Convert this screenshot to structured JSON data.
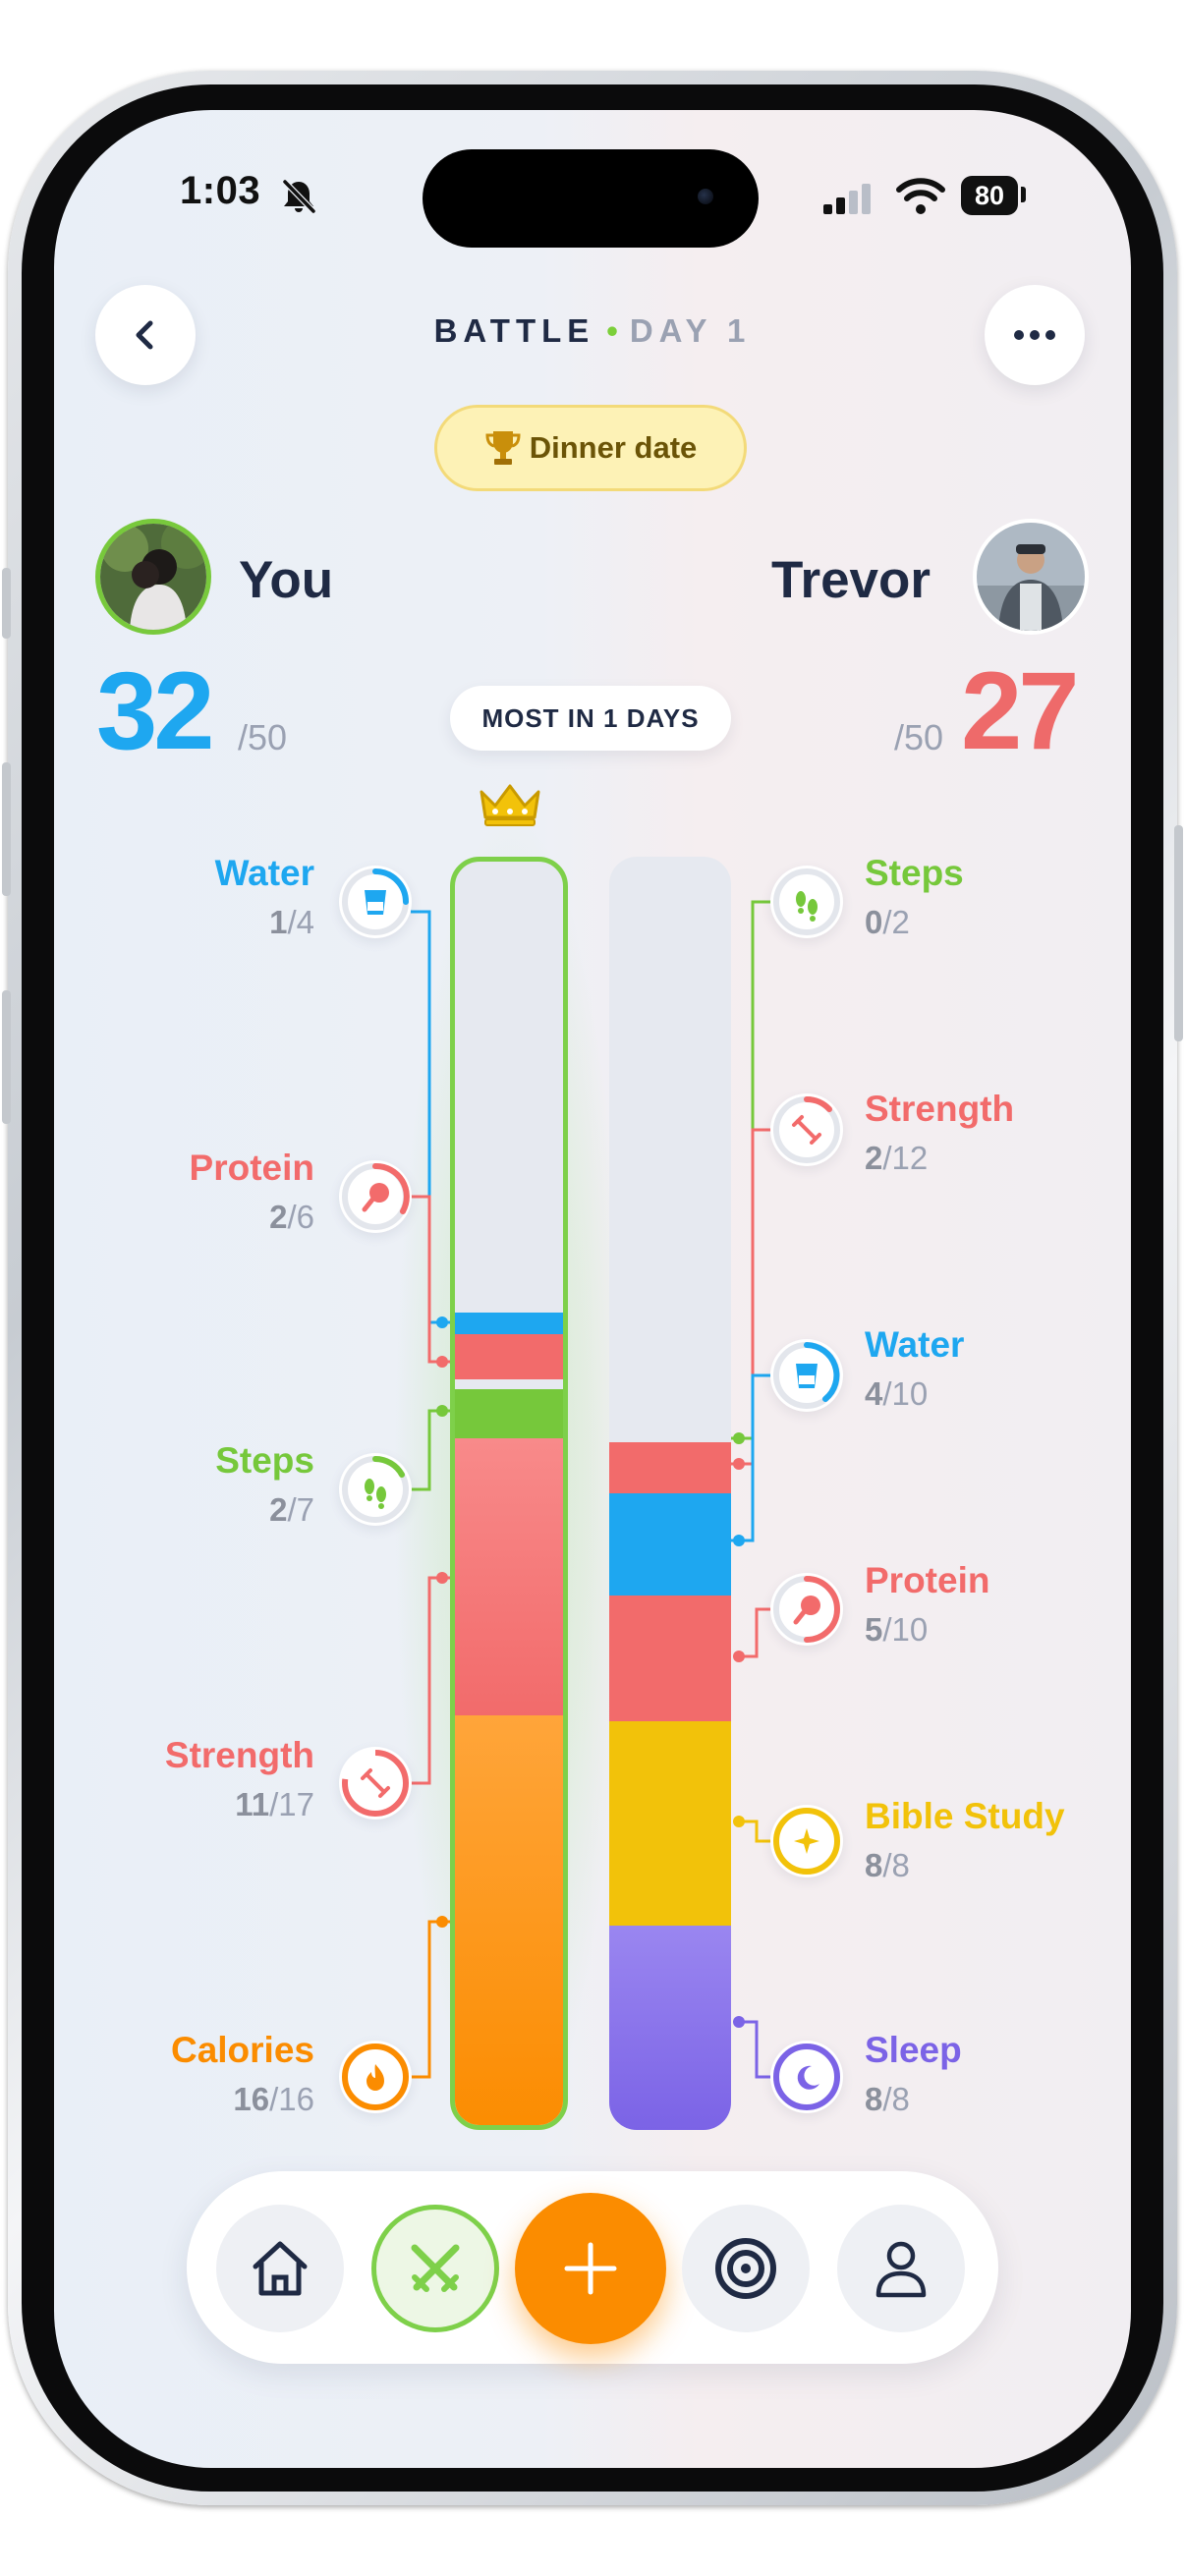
{
  "status_bar": {
    "time": "1:03",
    "battery": "80"
  },
  "header": {
    "title": "BATTLE",
    "separator": "•",
    "day": "DAY 1",
    "prize": "Dinner date"
  },
  "players": {
    "you": {
      "name": "You",
      "score": "32",
      "max": "/50"
    },
    "opponent": {
      "name": "Trevor",
      "score": "27",
      "max": "/50"
    }
  },
  "leader_label": "MOST IN 1 DAYS",
  "colors": {
    "water": "#1ea7f0",
    "protein": "#f26b6b",
    "steps": "#76c83b",
    "strength": "#f26b6b",
    "calories": "#fb8c00",
    "bible_study": "#f2c20a",
    "sleep": "#7b63e6",
    "you_score": "#1ea7f0",
    "trevor_score": "#ee6a6a"
  },
  "you_categories": [
    {
      "name": "Water",
      "done": "1",
      "total": "/4",
      "icon": "cup-icon"
    },
    {
      "name": "Protein",
      "done": "2",
      "total": "/6",
      "icon": "drumstick-icon"
    },
    {
      "name": "Steps",
      "done": "2",
      "total": "/7",
      "icon": "footprints-icon"
    },
    {
      "name": "Strength",
      "done": "11",
      "total": "/17",
      "icon": "dumbbell-icon"
    },
    {
      "name": "Calories",
      "done": "16",
      "total": "/16",
      "icon": "flame-icon"
    }
  ],
  "trevor_categories": [
    {
      "name": "Steps",
      "done": "0",
      "total": "/2",
      "icon": "footprints-icon"
    },
    {
      "name": "Strength",
      "done": "2",
      "total": "/12",
      "icon": "dumbbell-icon"
    },
    {
      "name": "Water",
      "done": "4",
      "total": "/10",
      "icon": "cup-icon"
    },
    {
      "name": "Protein",
      "done": "5",
      "total": "/10",
      "icon": "drumstick-icon"
    },
    {
      "name": "Bible Study",
      "done": "8",
      "total": "/8",
      "icon": "sparkle-icon"
    },
    {
      "name": "Sleep",
      "done": "8",
      "total": "/8",
      "icon": "moon-icon"
    }
  ],
  "nav": {
    "items": [
      "home-icon",
      "swords-icon",
      "plus-icon",
      "target-icon",
      "profile-icon"
    ]
  }
}
